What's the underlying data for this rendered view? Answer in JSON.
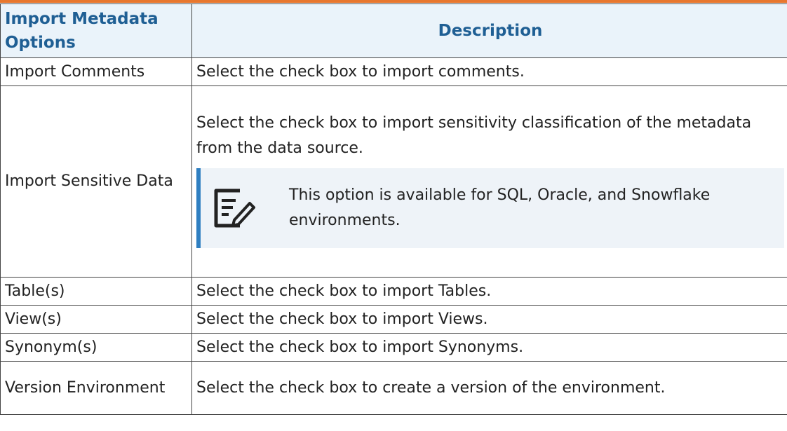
{
  "table": {
    "headers": [
      "Import Metadata Options",
      "Description"
    ],
    "rows": [
      {
        "option": "Import Comments",
        "description": "Select the check box to import comments."
      },
      {
        "option": "Import Sensitive Data",
        "description": "Select the check box to import sensitivity classification of the metadata from the data source.",
        "note": "This option is available for SQL, Oracle, and Snowflake environments."
      },
      {
        "option": "Table(s)",
        "description": "Select the check box to import Tables."
      },
      {
        "option": "View(s)",
        "description": "Select the check box to import Views."
      },
      {
        "option": "Synonym(s)",
        "description": "Select the check box to import Synonyms."
      },
      {
        "option": "Version Environment",
        "description": "Select the check box to create a version of the environment."
      }
    ]
  },
  "colors": {
    "top_rule": "#e8772e",
    "header_text": "#1f5f94",
    "header_bg": "#eaf3fa",
    "note_bar": "#2f7fc1",
    "note_bg": "#eef3f8"
  },
  "icons": {
    "note": "note-edit-icon"
  }
}
